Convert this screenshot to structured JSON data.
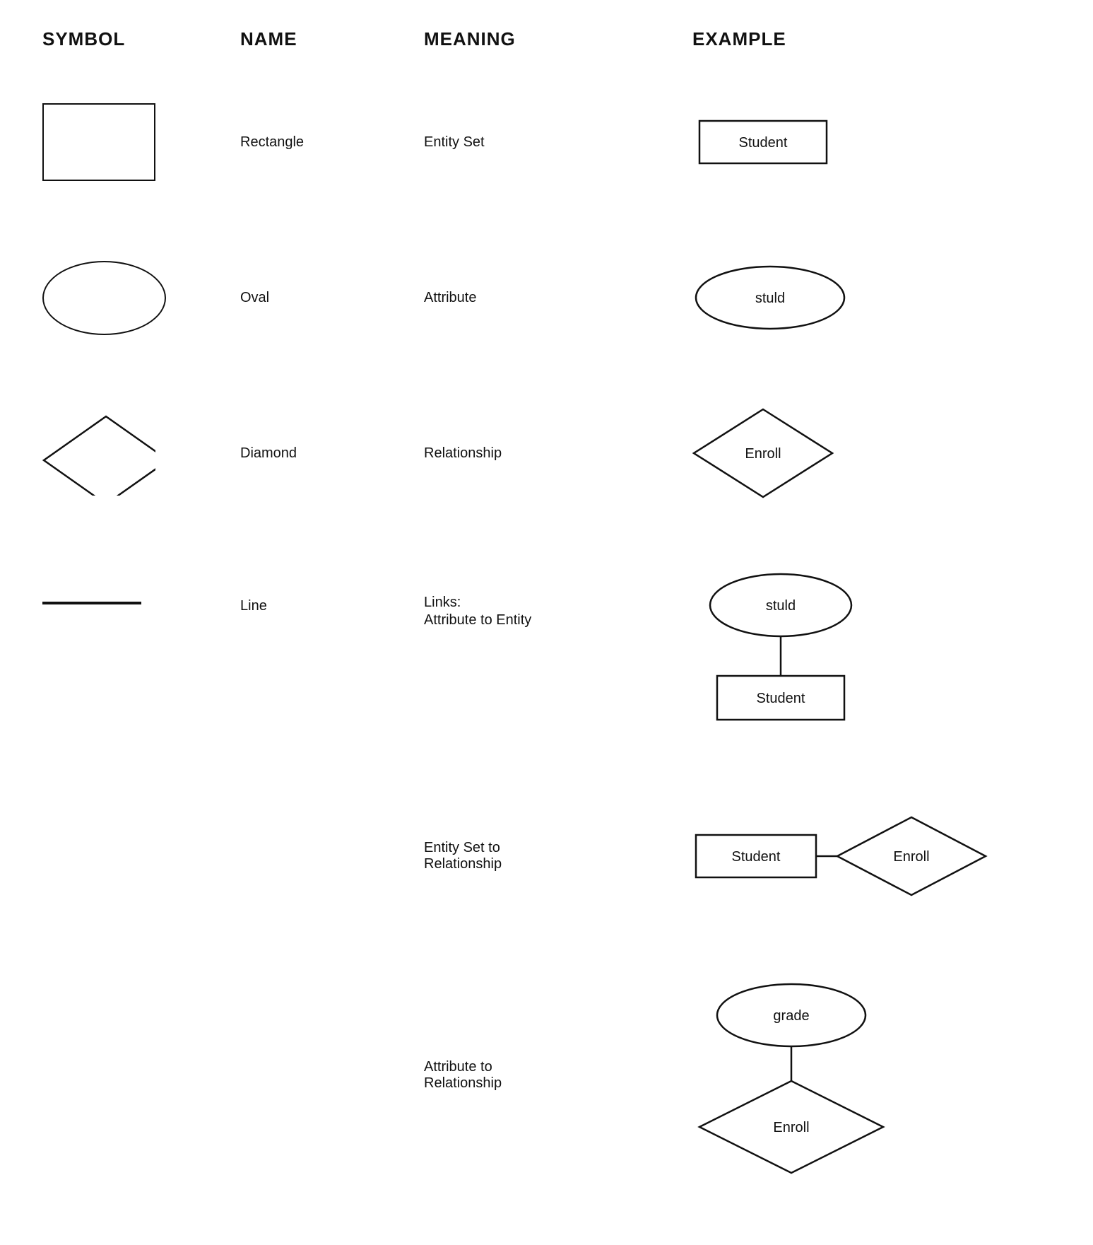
{
  "header": {
    "col1": "SYMBOL",
    "col2": "NAME",
    "col3": "MEANING",
    "col4": "EXAMPLE"
  },
  "rows": [
    {
      "id": "rectangle",
      "name": "Rectangle",
      "meaning": "Entity Set",
      "example_label": "Student",
      "shape": "rectangle"
    },
    {
      "id": "oval",
      "name": "Oval",
      "meaning": "Attribute",
      "example_label": "stuld",
      "shape": "oval"
    },
    {
      "id": "diamond",
      "name": "Diamond",
      "meaning": "Relationship",
      "example_label": "Enroll",
      "shape": "diamond"
    },
    {
      "id": "line",
      "name": "Line",
      "meaning_line1": "Links:",
      "meaning_line2": "Attribute to Entity",
      "shape": "line"
    }
  ],
  "bottom_rows": [
    {
      "id": "entity-to-rel",
      "meaning_line1": "Entity Set to",
      "meaning_line2": "Relationship",
      "entity_label": "Student",
      "rel_label": "Enroll"
    },
    {
      "id": "attr-to-rel",
      "meaning_line1": "Attribute to",
      "meaning_line2": "Relationship",
      "oval_label": "grade",
      "diamond_label": "Enroll"
    }
  ],
  "line_example": {
    "oval_label": "stuld",
    "rect_label": "Student"
  }
}
